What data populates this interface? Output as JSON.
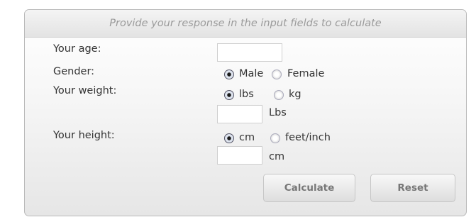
{
  "header": {
    "text": "Provide your response in the input fields to calculate"
  },
  "age": {
    "label": "Your age:",
    "value": ""
  },
  "gender": {
    "label": "Gender:",
    "options": [
      "Male",
      "Female"
    ],
    "selected": "Male"
  },
  "weight": {
    "label": "Your weight:",
    "options": [
      "lbs",
      "kg"
    ],
    "selected": "lbs",
    "value": "",
    "unit": "Lbs"
  },
  "height": {
    "label": "Your height:",
    "options": [
      "cm",
      "feet/inch"
    ],
    "selected": "cm",
    "value": "",
    "unit": "cm"
  },
  "buttons": {
    "calculate": "Calculate",
    "reset": "Reset"
  }
}
